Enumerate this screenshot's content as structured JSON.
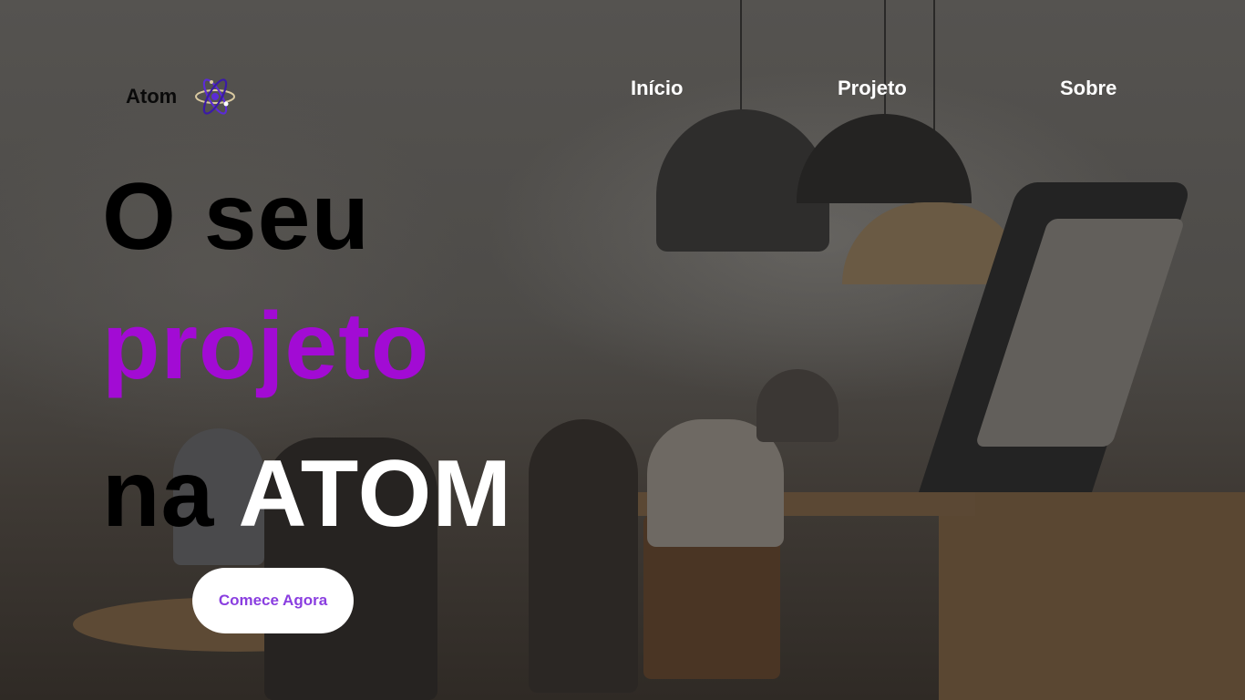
{
  "brand": {
    "name": "Atom",
    "icon": "atom-icon"
  },
  "nav": {
    "items": [
      {
        "label": "Início"
      },
      {
        "label": "Projeto"
      },
      {
        "label": "Sobre"
      }
    ]
  },
  "hero": {
    "line1": "O seu",
    "line2": "projeto",
    "line3_prefix": "na ",
    "line3_accent": "ATOM",
    "cta_label": "Comece Agora"
  },
  "colors": {
    "accent_purple": "#a20bd4",
    "cta_text": "#8a3ee0",
    "heading_dark": "#000000",
    "nav_text": "#ffffff"
  }
}
